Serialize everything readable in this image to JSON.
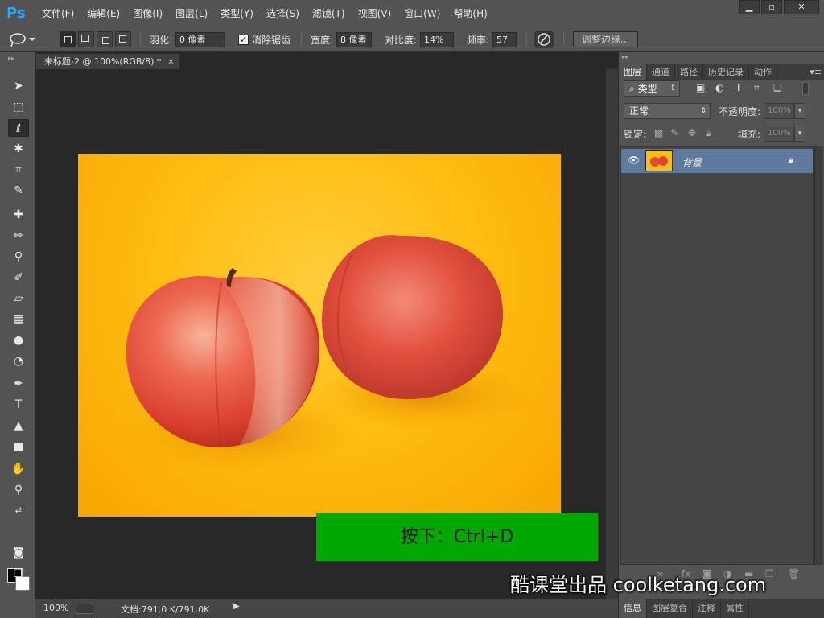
{
  "app": {
    "logo": "Ps"
  },
  "menubar": {
    "items": [
      "文件(F)",
      "编辑(E)",
      "图像(I)",
      "图层(L)",
      "类型(Y)",
      "选择(S)",
      "滤镜(T)",
      "视图(V)",
      "窗口(W)",
      "帮助(H)"
    ],
    "minimize": "▁",
    "restore": "▫",
    "close": "✕"
  },
  "options": {
    "feather_label": "羽化:",
    "feather_value": "0 像素",
    "antialias_label": "消除锯齿",
    "antialias_checked": "✓",
    "width_label": "宽度:",
    "width_value": "8 像素",
    "contrast_label": "对比度:",
    "contrast_value": "14%",
    "frequency_label": "频率:",
    "frequency_value": "57",
    "refine_edge": "调整边缘..."
  },
  "document": {
    "tab_title": "未标题-2 @ 100%(RGB/8) *",
    "tab_close": "×"
  },
  "status": {
    "zoom": "100%",
    "doc_info": "文档:791.0 K/791.0K"
  },
  "panels": {
    "tabs": [
      "图层",
      "通道",
      "路径",
      "历史记录",
      "动作"
    ],
    "filter_kind": "类型",
    "blend_mode": "正常",
    "opacity_label": "不透明度:",
    "opacity_value": "100%",
    "lock_label": "锁定:",
    "fill_label": "填充:",
    "fill_value": "100%",
    "layer_name": "背景",
    "bottom_tabs": [
      "信息",
      "图层复合",
      "注释",
      "属性"
    ]
  },
  "overlay": {
    "key_hint": "按下：Ctrl+D",
    "watermark": "酷课堂出品 coolketang.com"
  },
  "colors": {
    "accent": "#31a8ff",
    "layer_selected": "#5e7a9c",
    "key_hint_bg": "#00a800",
    "image_bg": "#ffbd12"
  }
}
